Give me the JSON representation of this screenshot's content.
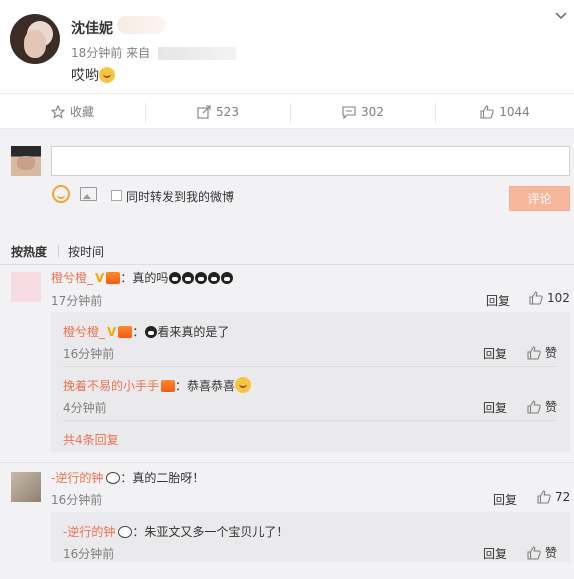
{
  "post": {
    "author": "沈佳妮",
    "time": "18分钟前",
    "source_prefix": "来自",
    "text": "哎哟"
  },
  "actions": {
    "favorite": "收藏",
    "repost_count": "523",
    "comment_count": "302",
    "like_count": "1044"
  },
  "composer": {
    "repost_label": "同时转发到我的微博",
    "submit_label": "评论"
  },
  "sort": {
    "hot": "按热度",
    "time": "按时间"
  },
  "comments": [
    {
      "name": "橙兮橙_",
      "text": "：真的吗",
      "time": "17分钟前",
      "reply": "回复",
      "likes": "102",
      "replies": [
        {
          "name": "橙兮橙_",
          "text": "看来真的是了",
          "time": "16分钟前",
          "reply": "回复",
          "likes": "赞"
        },
        {
          "name": "挽着不易的小手手",
          "text": "：恭喜恭喜",
          "time": "4分钟前",
          "reply": "回复",
          "likes": "赞"
        }
      ],
      "more": "共4条回复"
    },
    {
      "name": "-逆行的钟",
      "text": "：真的二胎呀！",
      "time": "16分钟前",
      "reply": "回复",
      "likes": "72",
      "replies": [
        {
          "name": "-逆行的钟",
          "text": "：朱亚文又多一个宝贝儿了！",
          "time": "16分钟前",
          "reply": "回复",
          "likes": "赞"
        }
      ]
    }
  ],
  "colors": {
    "accent": "#eb7350",
    "submit": "#f7b79c",
    "panel": "#f2f2f5"
  }
}
